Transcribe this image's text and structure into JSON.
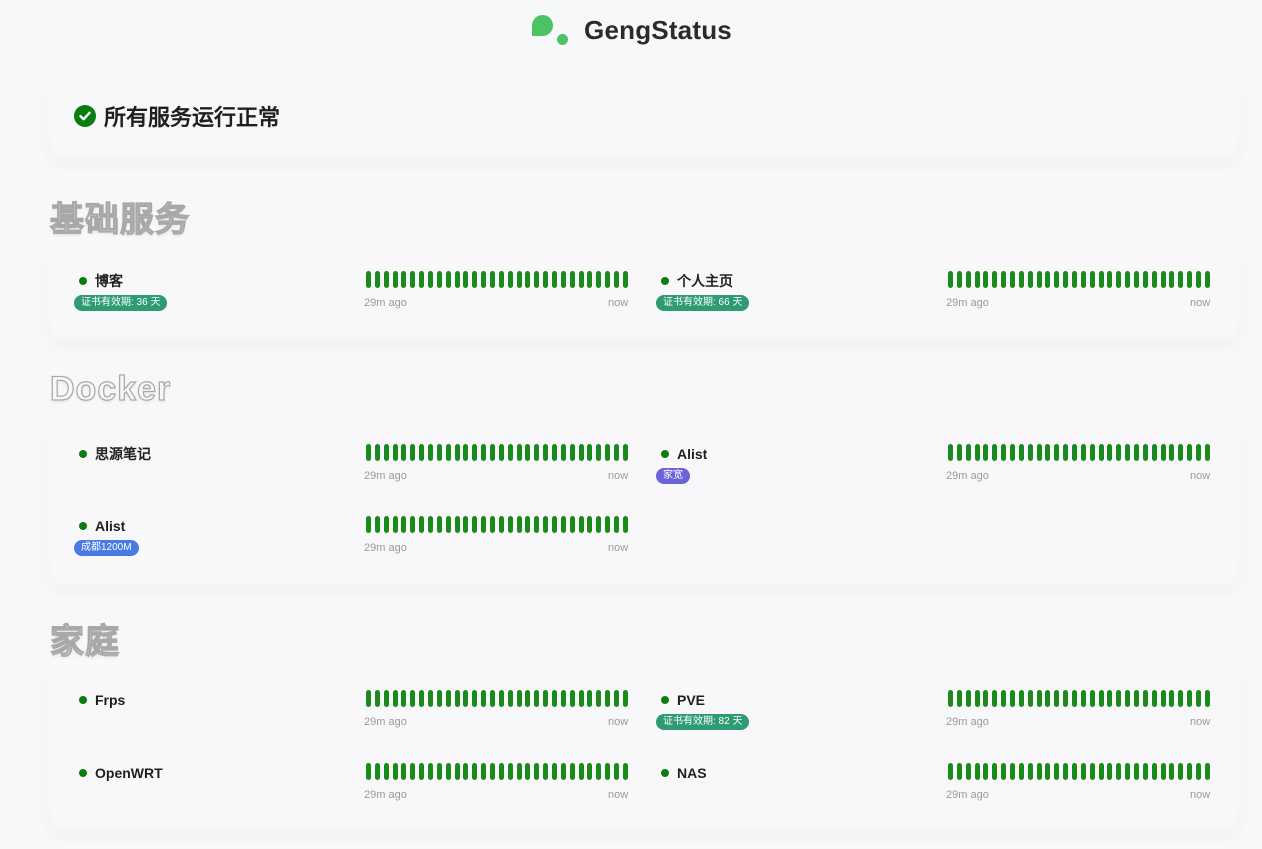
{
  "brand": {
    "name": "GengStatus",
    "color": "#4cc364"
  },
  "overall": {
    "text": "所有服务运行正常",
    "icon": "check-circle-icon",
    "color": "#0a7d12"
  },
  "time_labels": {
    "start": "29m ago",
    "end": "now"
  },
  "heartbeat_color": "#1a8a1a",
  "groups": [
    {
      "title": "基础服务",
      "monitors": [
        {
          "name": "博客",
          "tag": "证书有效期: 36 天",
          "tag_color": "#2e9b72",
          "status": "up"
        },
        {
          "name": "个人主页",
          "tag": "证书有效期: 66 天",
          "tag_color": "#2e9b72",
          "status": "up"
        }
      ]
    },
    {
      "title": "Docker",
      "monitors": [
        {
          "name": "思源笔记",
          "tag": "",
          "status": "up"
        },
        {
          "name": "Alist",
          "tag": "家宽",
          "tag_color": "#6c63d6",
          "status": "up"
        },
        {
          "name": "Alist",
          "tag": "成都1200M",
          "tag_color": "#4a7be0",
          "status": "up"
        }
      ]
    },
    {
      "title": "家庭",
      "monitors": [
        {
          "name": "Frps",
          "tag": "",
          "status": "up"
        },
        {
          "name": "PVE",
          "tag": "证书有效期: 82 天",
          "tag_color": "#2e9b72",
          "status": "up"
        },
        {
          "name": "OpenWRT",
          "tag": "",
          "status": "up"
        },
        {
          "name": "NAS",
          "tag": "",
          "status": "up"
        }
      ]
    }
  ]
}
